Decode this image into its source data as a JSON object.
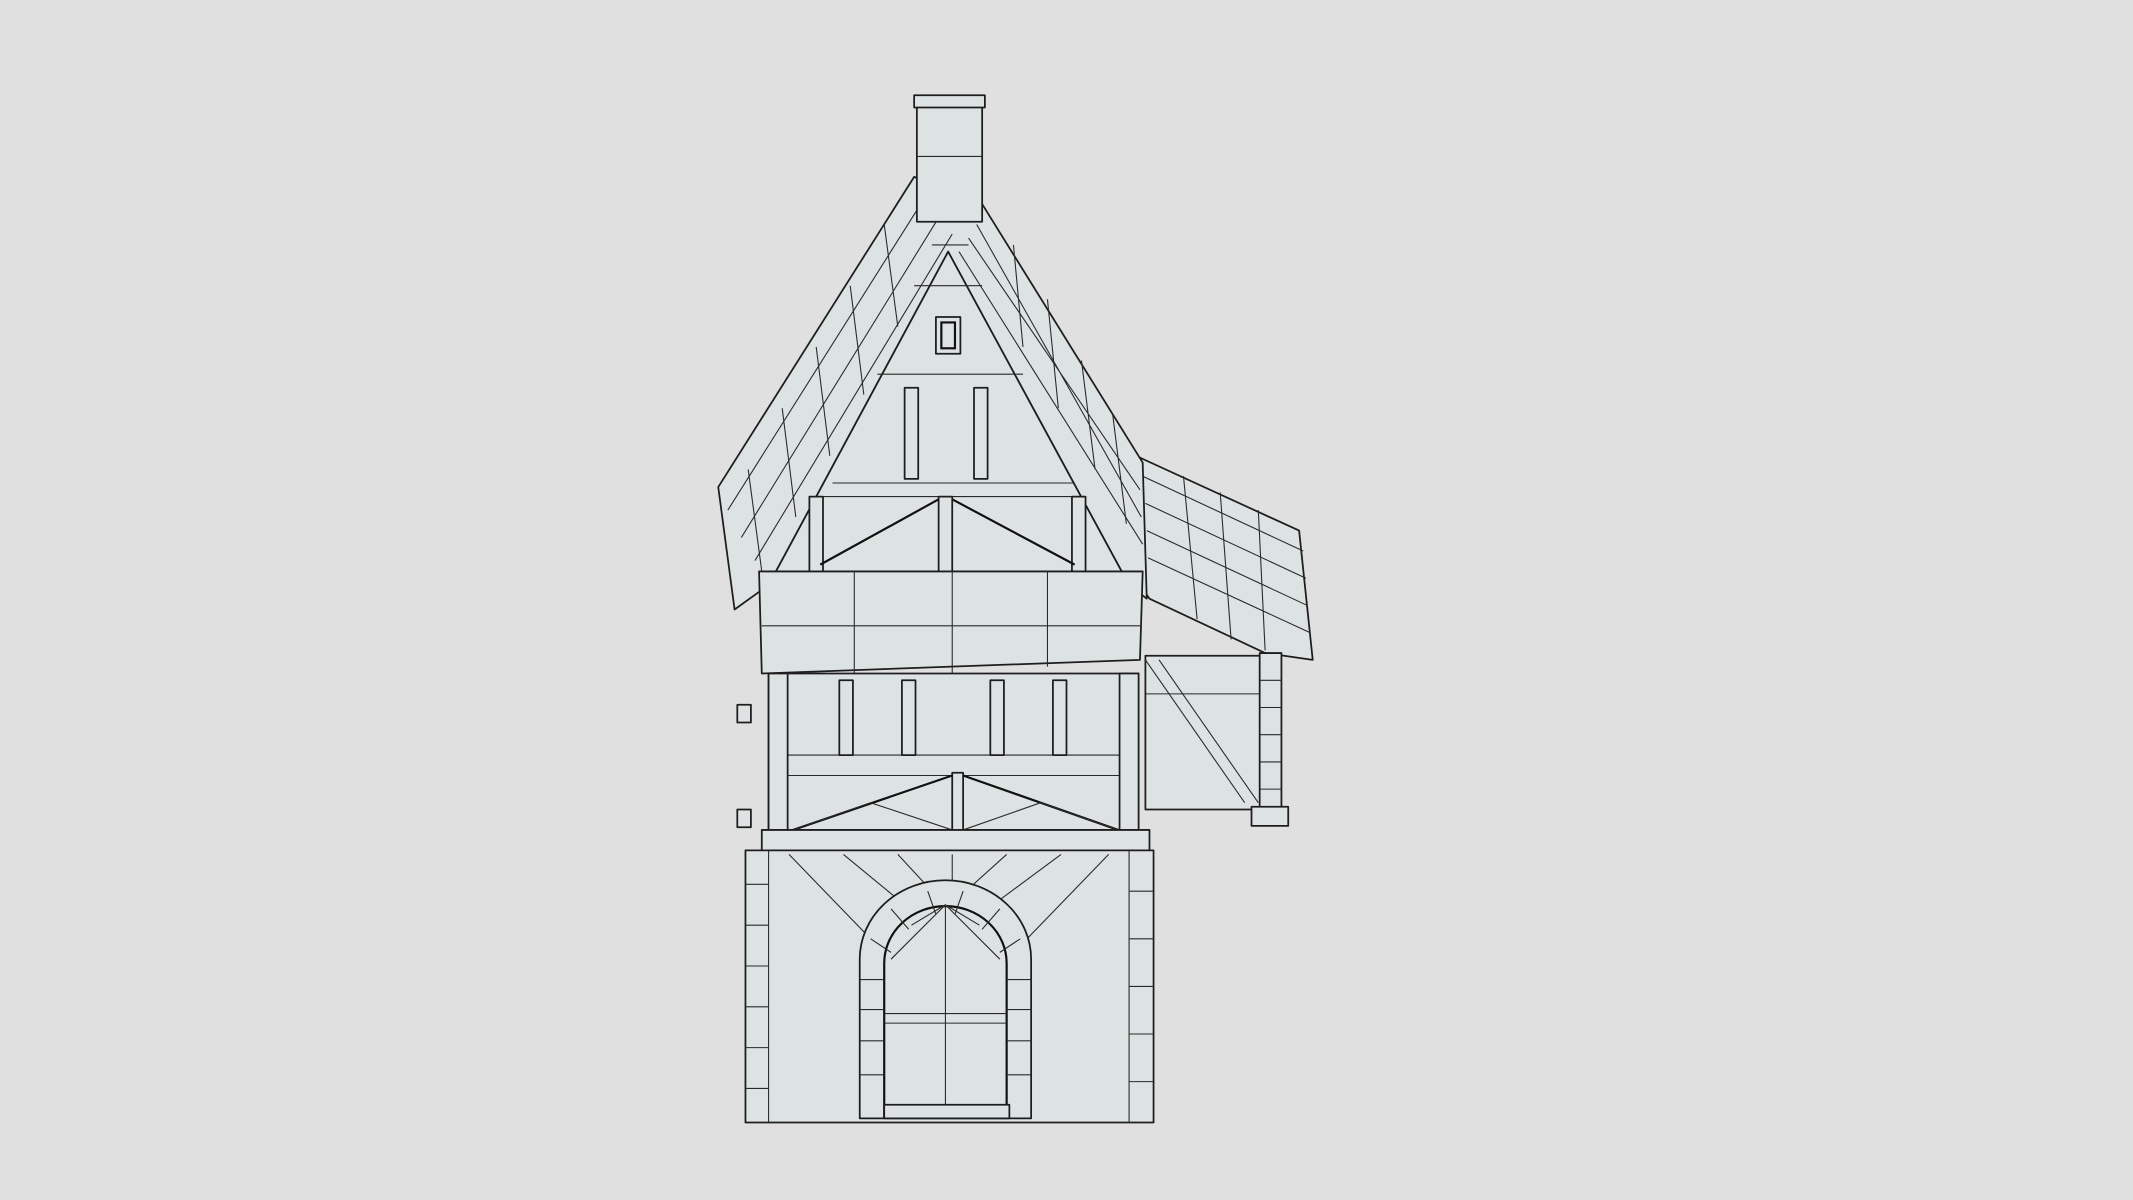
{
  "viewer": {
    "background_color": "#e0e0e0",
    "model_fill_color": "#dde3e3",
    "wire_color": "#1e1e1e",
    "render_mode": "wireframe"
  }
}
